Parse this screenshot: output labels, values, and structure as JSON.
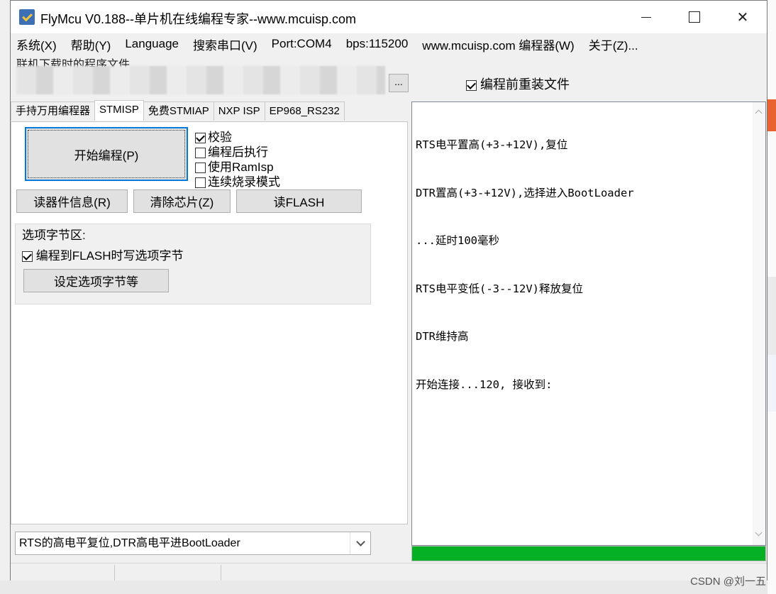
{
  "window": {
    "title": "FlyMcu V0.188--单片机在线编程专家--www.mcuisp.com",
    "min_label": "minimize",
    "max_label": "maximize",
    "close_label": "✕"
  },
  "menubar": [
    {
      "label": "系统(X)"
    },
    {
      "label": "帮助(Y)"
    },
    {
      "label": "Language"
    },
    {
      "label": "搜索串口(V)"
    },
    {
      "label": "Port:COM4"
    },
    {
      "label": "bps:115200"
    },
    {
      "label": "www.mcuisp.com 编程器(W)"
    },
    {
      "label": "关于(Z)..."
    }
  ],
  "file": {
    "label": "联机下载时的程序文件",
    "browse_label": "...",
    "reload_label": "编程前重装文件",
    "reload_checked": true
  },
  "tabs": [
    {
      "label": "手持万用编程器",
      "active": false
    },
    {
      "label": "STMISP",
      "active": true
    },
    {
      "label": "免费STMIAP",
      "active": false
    },
    {
      "label": "NXP ISP",
      "active": false
    },
    {
      "label": "EP968_RS232",
      "active": false
    }
  ],
  "stmisp": {
    "start_button": "开始编程(P)",
    "options": [
      {
        "label": "校验",
        "checked": true
      },
      {
        "label": "编程后执行",
        "checked": false
      },
      {
        "label": "使用RamIsp",
        "checked": false
      },
      {
        "label": "连续烧录模式",
        "checked": false
      }
    ],
    "read_info_button": "读器件信息(R)",
    "erase_button": "清除芯片(Z)",
    "read_flash_button": "读FLASH",
    "optbytes": {
      "title": "选项字节区:",
      "write_label": "编程到FLASH时写选项字节",
      "write_checked": true,
      "set_button": "设定选项字节等"
    }
  },
  "mode_select": {
    "value": "RTS的高电平复位,DTR高电平进BootLoader"
  },
  "log": [
    "RTS电平置高(+3-+12V),复位",
    "DTR置高(+3-+12V),选择进入BootLoader",
    "...延时100毫秒",
    "RTS电平变低(-3--12V)释放复位",
    "DTR维持高",
    "开始连接...120, 接收到:"
  ],
  "progress": {
    "fraction": 1.0,
    "color": "#06b025"
  },
  "watermark": "CSDN @刘一五"
}
